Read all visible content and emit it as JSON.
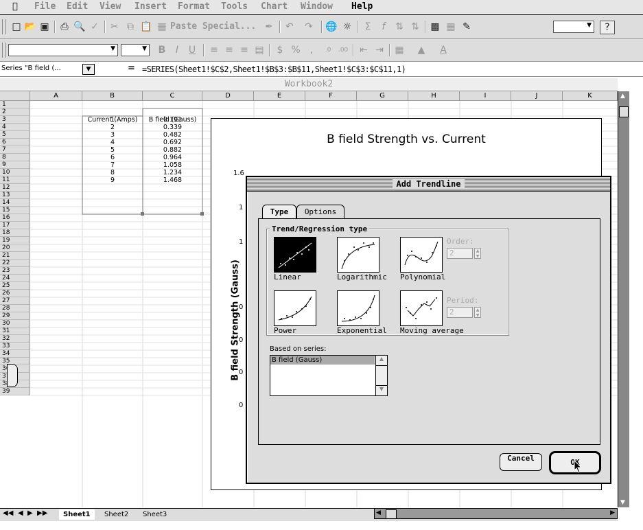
{
  "menubar": {
    "apple": "",
    "items": [
      "File",
      "Edit",
      "View",
      "Insert",
      "Format",
      "Tools",
      "Chart",
      "Window",
      "Help"
    ]
  },
  "toolbar": {
    "paste_special": "Paste Special..."
  },
  "formula_bar": {
    "name_box": "Series \"B field (...",
    "equals": "=",
    "formula": "=SERIES(Sheet1!$C$2,Sheet1!$B$3:$B$11,Sheet1!$C$3:$C$11,1)"
  },
  "workbook": {
    "title": "Workbook2",
    "columns": [
      "A",
      "B",
      "C",
      "D",
      "E",
      "F",
      "G",
      "H",
      "I",
      "J",
      "K"
    ],
    "rows": [
      "1",
      "2",
      "3",
      "4",
      "5",
      "6",
      "7",
      "8",
      "9",
      "10",
      "11",
      "12",
      "13",
      "14",
      "15",
      "16",
      "17",
      "18",
      "19",
      "20",
      "21",
      "22",
      "23",
      "24",
      "25",
      "26",
      "27",
      "28",
      "29",
      "30",
      "31",
      "32",
      "33",
      "34",
      "35",
      "36",
      "37",
      "38",
      "39"
    ],
    "headers": {
      "b": "Current (Amps)",
      "c": "B field (Gauss)"
    },
    "data": [
      {
        "b": "1",
        "c": "0.191"
      },
      {
        "b": "2",
        "c": "0.339"
      },
      {
        "b": "3",
        "c": "0.482"
      },
      {
        "b": "4",
        "c": "0.692"
      },
      {
        "b": "5",
        "c": "0.882"
      },
      {
        "b": "6",
        "c": "0.964"
      },
      {
        "b": "7",
        "c": "1.058"
      },
      {
        "b": "8",
        "c": "1.234"
      },
      {
        "b": "9",
        "c": "1.468"
      }
    ],
    "sheet_tabs": [
      "Sheet1",
      "Sheet2",
      "Sheet3"
    ]
  },
  "chart": {
    "title": "B field Strength vs. Current",
    "ylabel": "B field Strength (Gauss)",
    "visible_ticks": [
      "1.6",
      "1",
      "1",
      "0",
      "0",
      "0",
      "0"
    ]
  },
  "dialog": {
    "title": "Add Trendline",
    "tabs": [
      "Type",
      "Options"
    ],
    "group_title": "Trend/Regression type",
    "types": [
      "Linear",
      "Logarithmic",
      "Polynomial",
      "Power",
      "Exponential",
      "Moving average"
    ],
    "order_label": "Order:",
    "order_value": "2",
    "period_label": "Period:",
    "period_value": "2",
    "based_on_label": "Based on series:",
    "series": [
      "B field (Gauss)"
    ],
    "cancel": "Cancel",
    "ok": "OK"
  }
}
